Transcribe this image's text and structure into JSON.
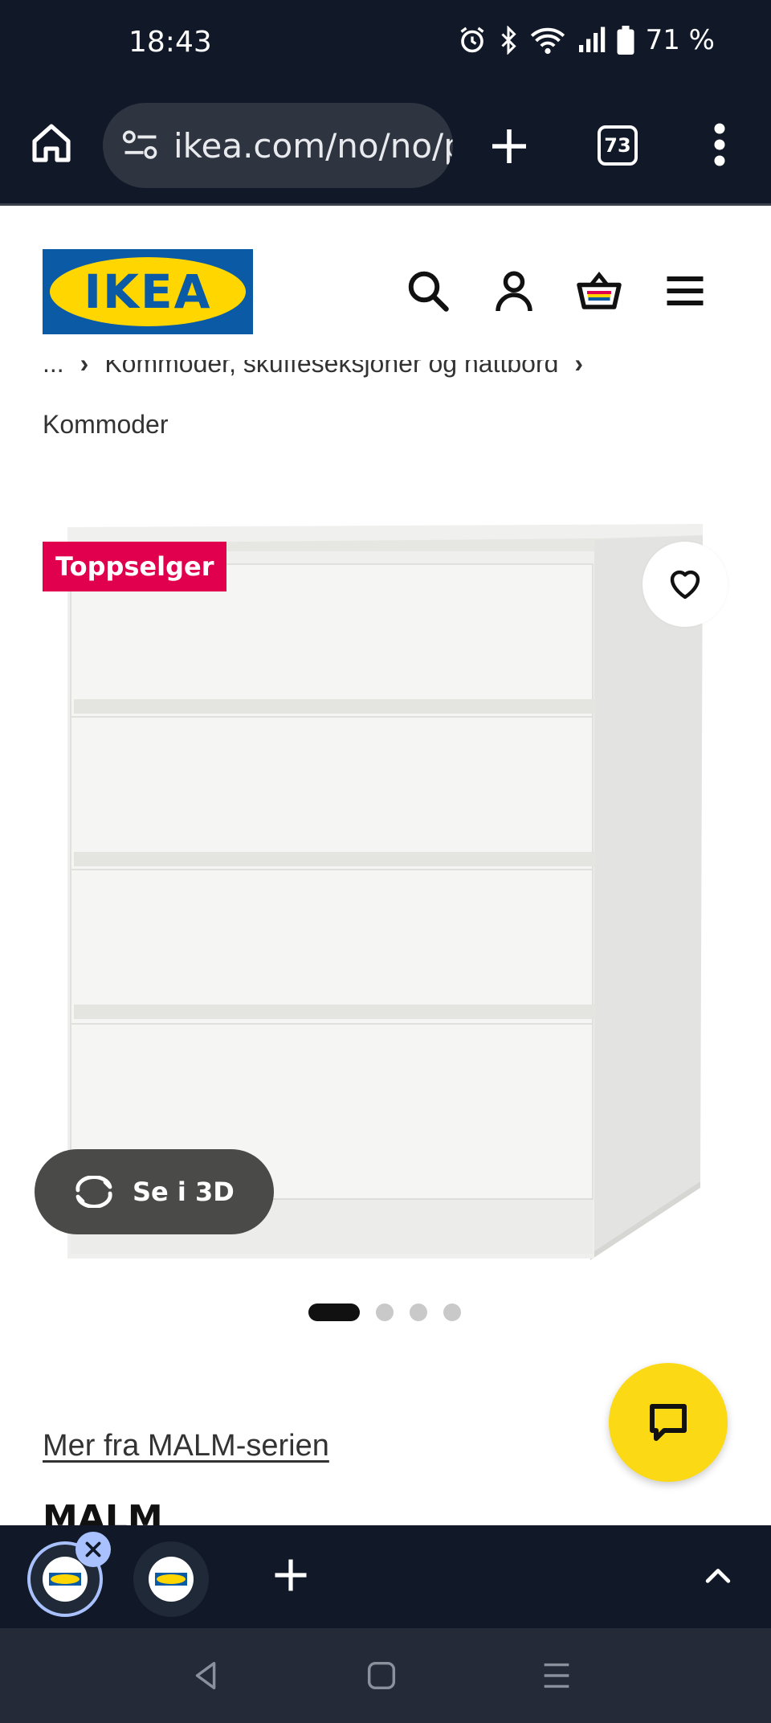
{
  "status_bar": {
    "time": "18:43",
    "battery": "71 %",
    "icons": [
      "alarm-icon",
      "bluetooth-icon",
      "wifi-icon",
      "signal-icon",
      "battery-icon"
    ]
  },
  "browser": {
    "url": "ikea.com/no/no/p",
    "tab_count": "73"
  },
  "site": {
    "logo_text": "IKEA",
    "header_icons": [
      "search-icon",
      "account-icon",
      "cart-icon",
      "hamburger-menu-icon"
    ]
  },
  "breadcrumb": {
    "ellipsis": "...",
    "parent": "Kommoder, skuffeseksjoner og nattbord",
    "current": "Kommoder"
  },
  "product": {
    "badge": "Toppselger",
    "view_3d_label": "Se i 3D",
    "image_count": 4,
    "active_image": 1,
    "series_link": "Mer fra MALM-serien",
    "name": "MALM"
  },
  "colors": {
    "ikea_blue": "#0a5aa6",
    "ikea_yellow": "#ffd600",
    "badge_red": "#e0004d",
    "chat_yellow": "#fbd914",
    "browser_dark": "#111827"
  }
}
